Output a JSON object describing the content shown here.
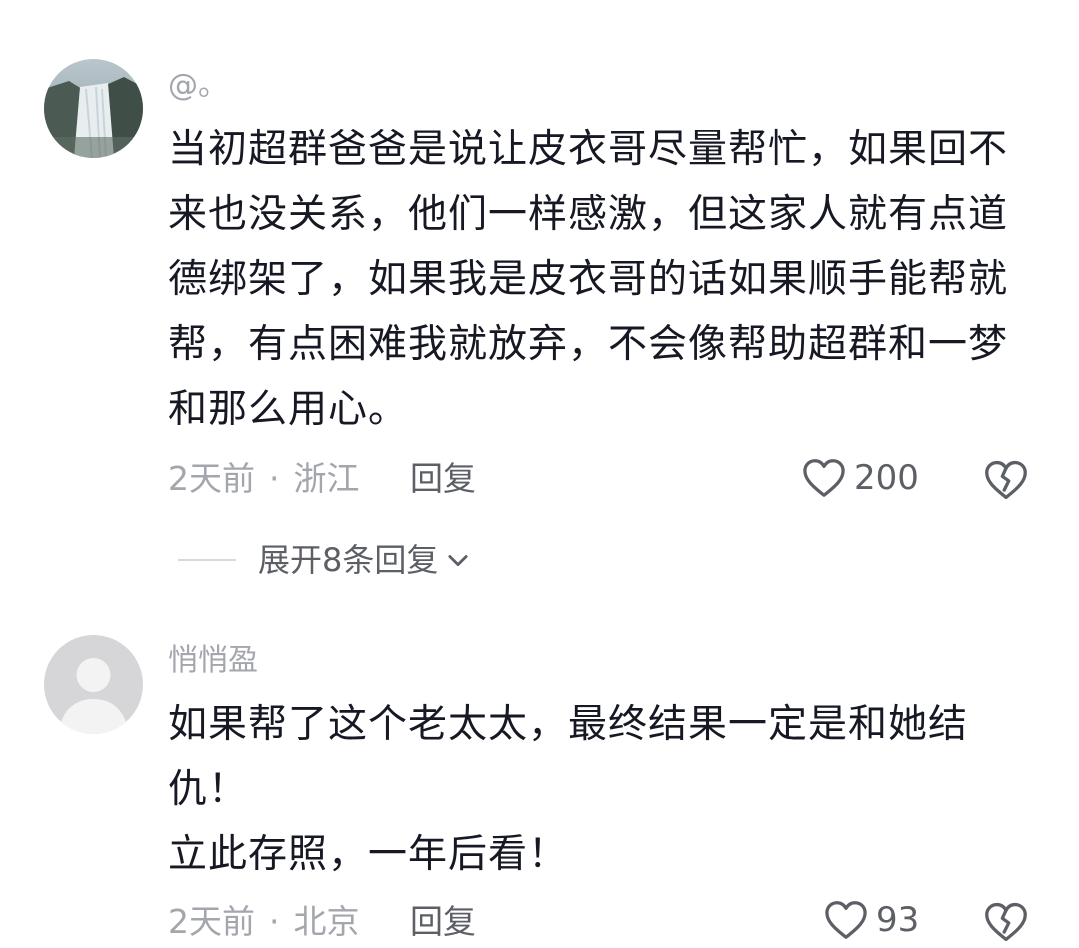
{
  "comments": [
    {
      "username": "@。",
      "lines": [
        "当初超群爸爸是说让皮衣哥尽量帮忙，如果回不",
        "来也没关系，他们一样感激，但这家人就有点道",
        "德绑架了，如果我是皮衣哥的话如果顺手能帮就",
        "帮，有点困难我就放弃，不会像帮助超群和一梦",
        "和那么用心。"
      ],
      "time": "2天前",
      "location": "浙江",
      "reply_label": "回复",
      "likes": "200"
    },
    {
      "username": "悄悄盈",
      "lines": [
        "如果帮了这个老太太，最终结果一定是和她结",
        "仇！",
        "立此存照，一年后看！"
      ],
      "time": "2天前",
      "location": "北京",
      "reply_label": "回复",
      "likes": "93"
    }
  ],
  "expand_replies": {
    "label": "展开8条回复"
  },
  "separator": "·",
  "icons": {
    "like": "heart-outline-icon",
    "dislike": "broken-heart-icon",
    "expand": "chevron-down-icon"
  },
  "colors": {
    "text_primary": "#161823",
    "text_secondary": "#a4a6ad",
    "text_action": "#5d5f66"
  }
}
